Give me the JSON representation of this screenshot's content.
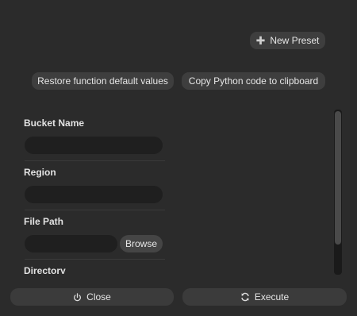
{
  "toolbar": {
    "new_preset_label": "New Preset",
    "restore_label": "Restore function default values",
    "copy_label": "Copy Python code to clipboard"
  },
  "form": {
    "fields": [
      {
        "label": "Bucket Name",
        "value": ""
      },
      {
        "label": "Region",
        "value": ""
      },
      {
        "label": "File Path",
        "value": ""
      },
      {
        "label": "Directory"
      }
    ],
    "browse_label": "Browse"
  },
  "footer": {
    "close_label": "Close",
    "execute_label": "Execute"
  },
  "icons": {
    "new_preset": "plus-icon",
    "close": "power-icon",
    "execute": "refresh-icon"
  }
}
